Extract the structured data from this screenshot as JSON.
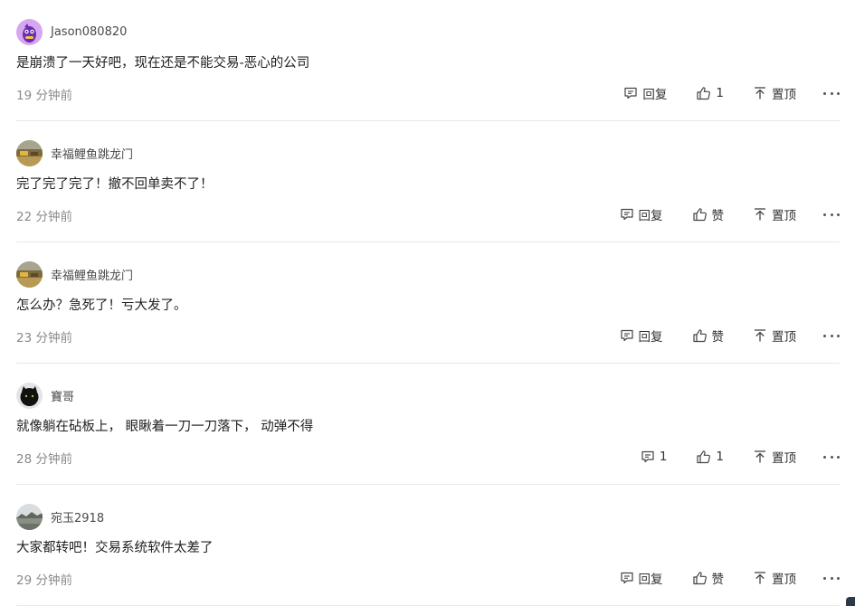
{
  "comments": [
    {
      "username": "Jason080820",
      "avatar": "purple-cartoon-avatar",
      "text": "是崩溃了一天好吧，现在还是不能交易-恶心的公司",
      "time": "19 分钟前",
      "reply_label": "回复",
      "like_label": "1",
      "pin_label": "置顶"
    },
    {
      "username": "幸福鲤鱼跳龙门",
      "avatar": "landscape-photo-avatar",
      "text": "完了完了完了！撤不回单卖不了！",
      "time": "22 分钟前",
      "reply_label": "回复",
      "like_label": "赞",
      "pin_label": "置顶"
    },
    {
      "username": "幸福鲤鱼跳龙门",
      "avatar": "landscape-photo-avatar",
      "text": "怎么办？急死了！亏大发了。",
      "time": "23 分钟前",
      "reply_label": "回复",
      "like_label": "赞",
      "pin_label": "置顶"
    },
    {
      "username": "寶哥",
      "avatar": "black-cat-avatar",
      "text": "就像躺在砧板上， 眼瞅着一刀一刀落下， 动弹不得",
      "time": "28 分钟前",
      "reply_label": "1",
      "like_label": "1",
      "pin_label": "置顶"
    },
    {
      "username": "宛玉2918",
      "avatar": "scenery-photo-avatar",
      "text": "大家都转吧！交易系统软件太差了",
      "time": "29 分钟前",
      "reply_label": "回复",
      "like_label": "赞",
      "pin_label": "置顶"
    }
  ],
  "icons": {
    "reply": "comment-bubble-icon",
    "like": "thumbs-up-icon",
    "pin": "pin-to-top-icon",
    "more": "more-dots-icon"
  },
  "colors": {
    "text": "#1f1f1f",
    "muted": "#8a8a8a",
    "divider": "#e8e8e8"
  }
}
